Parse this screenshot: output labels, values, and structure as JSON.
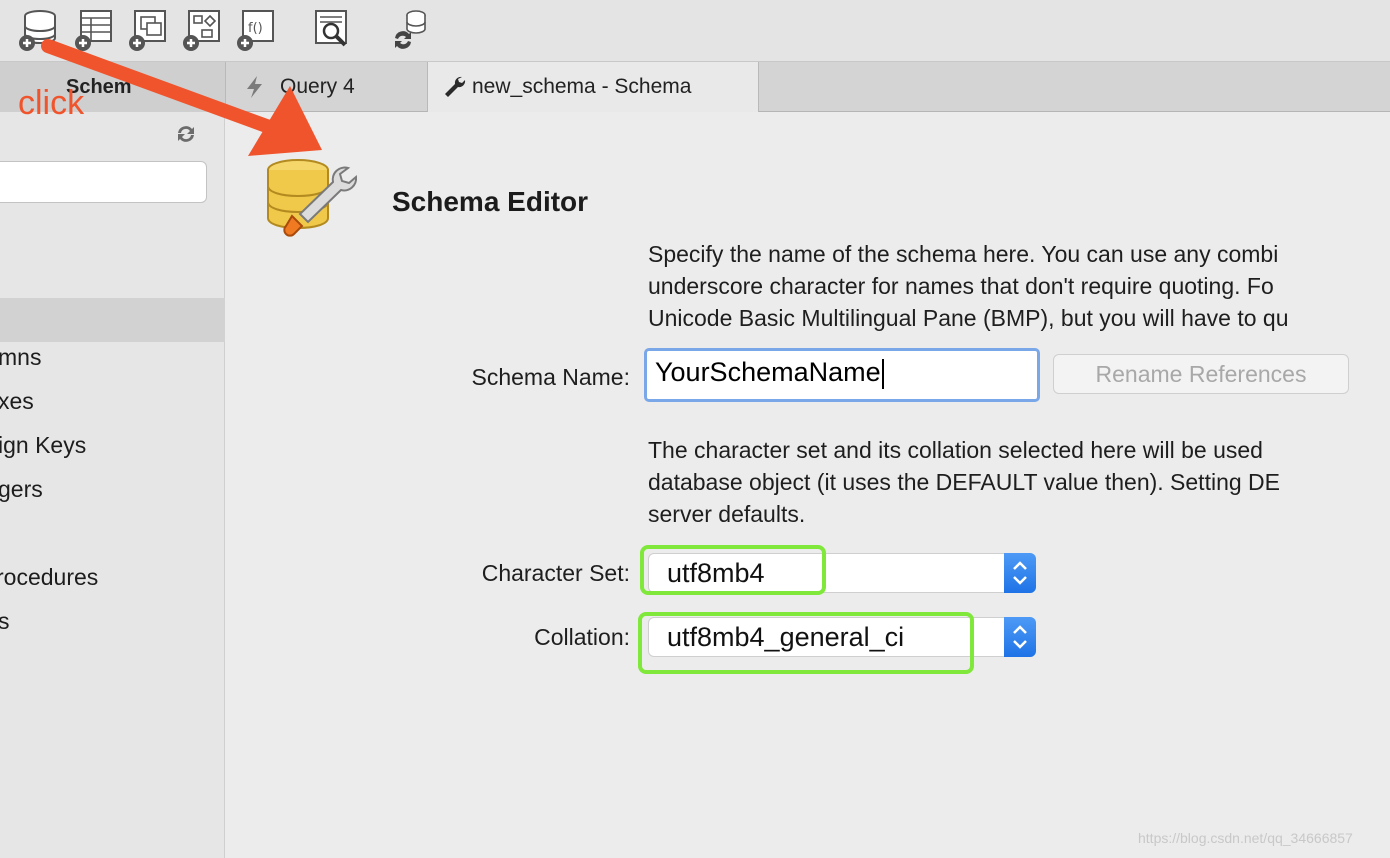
{
  "toolbar": {
    "buttons": [
      {
        "name": "new-schema-icon"
      },
      {
        "name": "new-table-icon"
      },
      {
        "name": "new-view-icon"
      },
      {
        "name": "new-procedure-icon"
      },
      {
        "name": "new-function-icon"
      },
      {
        "name": "inspector-icon"
      },
      {
        "name": "reconnect-icon"
      }
    ]
  },
  "tabs": [
    {
      "label": "Schem",
      "icon": "none"
    },
    {
      "label": "Query 4",
      "icon": "lightning-icon"
    },
    {
      "label": "new_schema - Schema",
      "icon": "wrench-icon"
    }
  ],
  "sidebar": {
    "items": [
      "mns",
      "xes",
      "ign Keys",
      "gers",
      "rocedures",
      "s"
    ]
  },
  "editor": {
    "title": "Schema Editor",
    "name_help": [
      "Specify the name of the schema here. You can use any combi",
      "underscore character for names that don't require quoting. Fo",
      "Unicode Basic Multilingual Pane (BMP), but you will have to qu"
    ],
    "schema_name_label": "Schema Name:",
    "schema_name_value": "YourSchemaName",
    "rename_button": "Rename References",
    "charset_help": [
      "The character set and its collation selected here will be used",
      "database object (it uses the DEFAULT value then). Setting DE",
      "server defaults."
    ],
    "charset_label": "Character Set:",
    "charset_value": "utf8mb4",
    "collation_label": "Collation:",
    "collation_value": "utf8mb4_general_ci"
  },
  "annotation": {
    "click_label": "click",
    "arrow_color": "#f0542d",
    "highlight_color": "#7fe83a"
  },
  "watermark": "https://blog.csdn.net/qq_34666857"
}
